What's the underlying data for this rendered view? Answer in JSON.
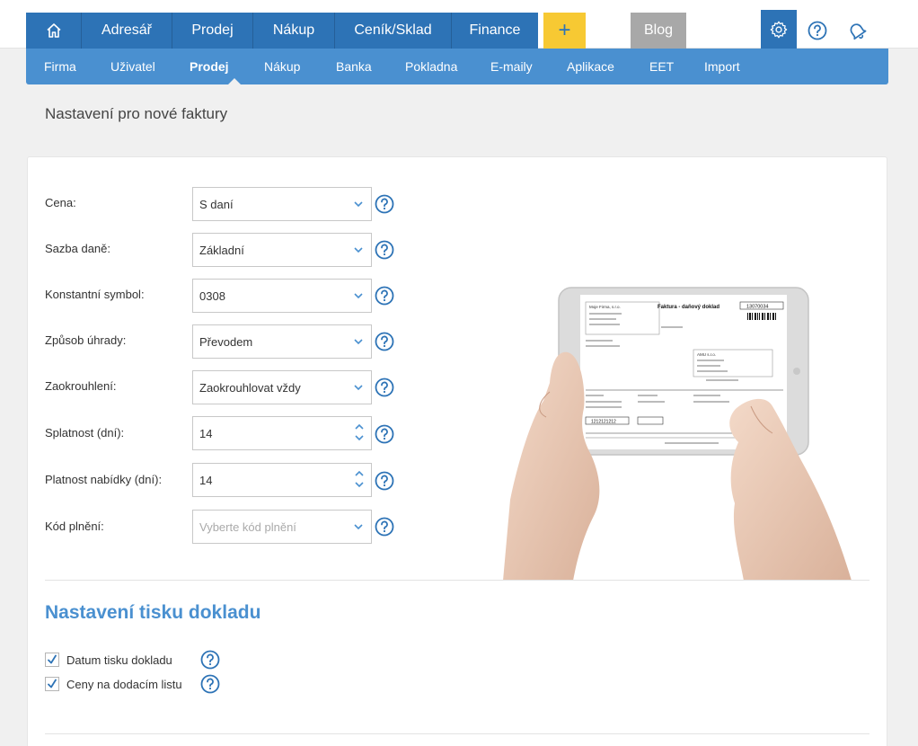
{
  "main_nav": {
    "home_icon": "home-icon",
    "items": [
      "Adresář",
      "Prodej",
      "Nákup",
      "Ceník/Sklad",
      "Finance"
    ],
    "add_label": "+",
    "blog_label": "Blog",
    "settings_icon": "gear-icon",
    "help_icon": "help-icon",
    "notifications_icon": "bell-icon"
  },
  "sub_nav": {
    "items": [
      "Firma",
      "Uživatel",
      "Prodej",
      "Nákup",
      "Banka",
      "Pokladna",
      "E-maily",
      "Aplikace",
      "EET",
      "Import"
    ],
    "active": "Prodej"
  },
  "page": {
    "title": "Nastavení pro nové faktury"
  },
  "form": {
    "fields": [
      {
        "label": "Cena:",
        "value": "S daní",
        "type": "select"
      },
      {
        "label": "Sazba daně:",
        "value": "Základní",
        "type": "select"
      },
      {
        "label": "Konstantní symbol:",
        "value": "0308",
        "type": "select"
      },
      {
        "label": "Způsob úhrady:",
        "value": "Převodem",
        "type": "select"
      },
      {
        "label": "Zaokrouhlení:",
        "value": "Zaokrouhlovat vždy",
        "type": "select"
      },
      {
        "label": "Splatnost (dní):",
        "value": "14",
        "type": "number"
      },
      {
        "label": "Platnost nabídky (dní):",
        "value": "14",
        "type": "number"
      },
      {
        "label": "Kód plnění:",
        "placeholder": "Vyberte kód plnění",
        "type": "select"
      }
    ]
  },
  "print_settings": {
    "title": "Nastavení tisku dokladu",
    "checkboxes": [
      {
        "label": "Datum tisku dokladu",
        "checked": true
      },
      {
        "label": "Ceny na dodacím listu",
        "checked": true
      }
    ]
  },
  "invoice_preview": {
    "title": "Faktura - daňový doklad",
    "number": "13070034",
    "seller": "Moje Firma, s.r.o.",
    "buyer": "AMU s.r.o.",
    "amount": "1212121212"
  },
  "colors": {
    "nav_blue": "#2d73b6",
    "subnav_blue": "#4a90d0",
    "accent_yellow": "#f7c933",
    "blog_gray": "#a8a8a8"
  }
}
